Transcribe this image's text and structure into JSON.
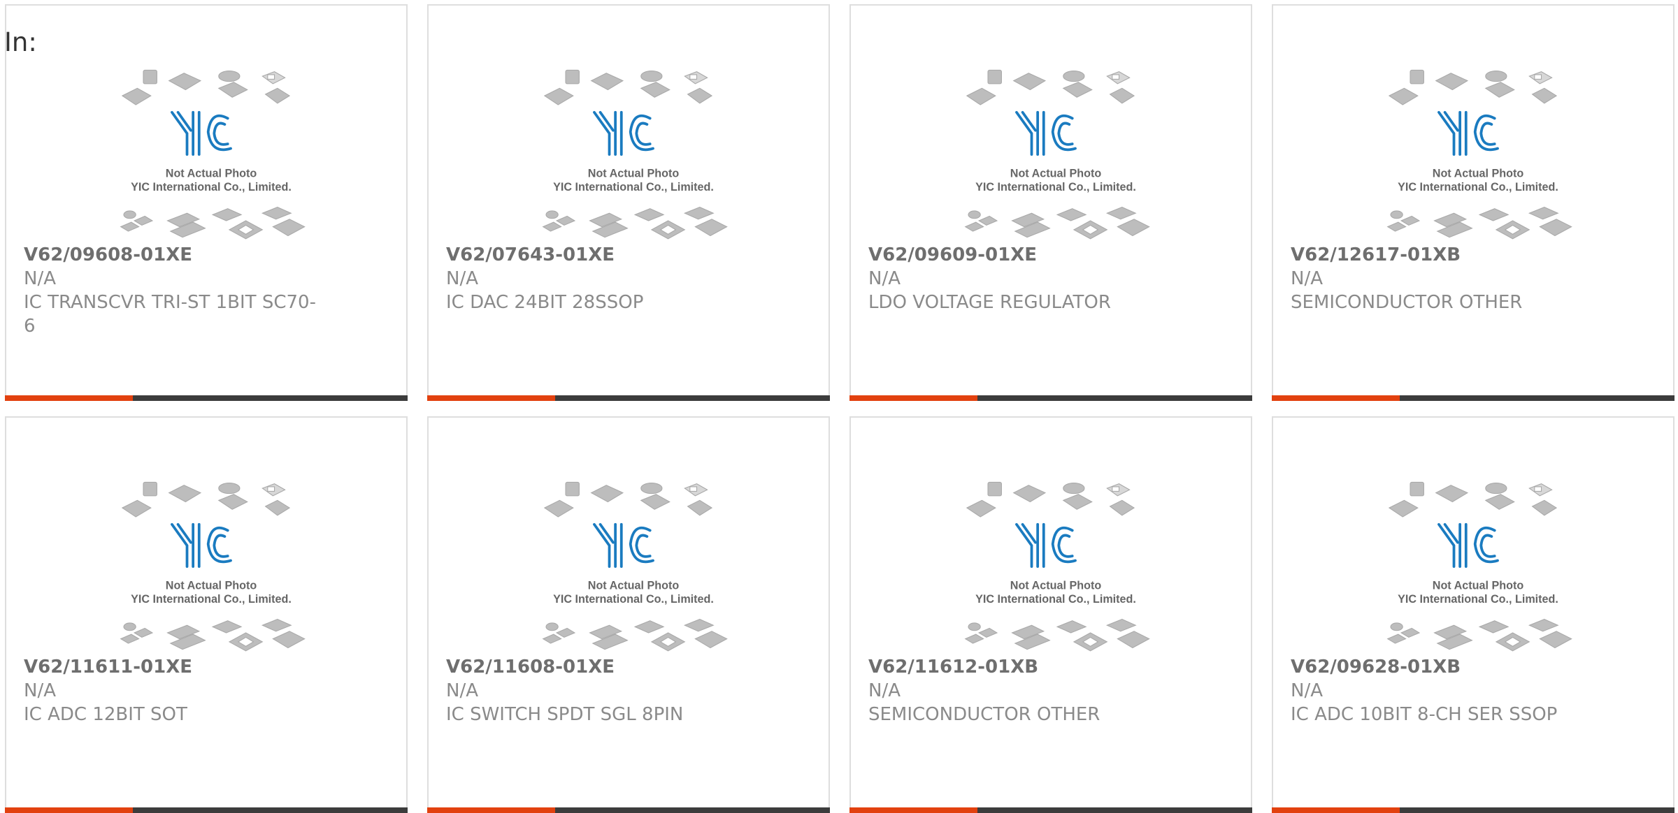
{
  "header": {
    "label": "In:"
  },
  "placeholder_image": {
    "line1": "Not Actual Photo",
    "line2": "YIC International Co., Limited."
  },
  "colors": {
    "accent": "#e2410f",
    "bar": "#3c3c3c",
    "logo_blue": "#1a7bc0",
    "border": "#dedede"
  },
  "products": [
    {
      "part": "V62/09608-01XE",
      "manufacturer": "N/A",
      "description": "IC TRANSCVR TRI-ST 1BIT SC70-6"
    },
    {
      "part": "V62/07643-01XE",
      "manufacturer": "N/A",
      "description": "IC DAC 24BIT 28SSOP"
    },
    {
      "part": "V62/09609-01XE",
      "manufacturer": "N/A",
      "description": "LDO VOLTAGE REGULATOR"
    },
    {
      "part": "V62/12617-01XB",
      "manufacturer": "N/A",
      "description": "SEMICONDUCTOR OTHER"
    },
    {
      "part": "V62/11611-01XE",
      "manufacturer": "N/A",
      "description": "IC ADC 12BIT SOT"
    },
    {
      "part": "V62/11608-01XE",
      "manufacturer": "N/A",
      "description": "IC SWITCH SPDT SGL 8PIN"
    },
    {
      "part": "V62/11612-01XB",
      "manufacturer": "N/A",
      "description": "SEMICONDUCTOR OTHER"
    },
    {
      "part": "V62/09628-01XB",
      "manufacturer": "N/A",
      "description": "IC ADC 10BIT 8-CH SER SSOP"
    }
  ]
}
